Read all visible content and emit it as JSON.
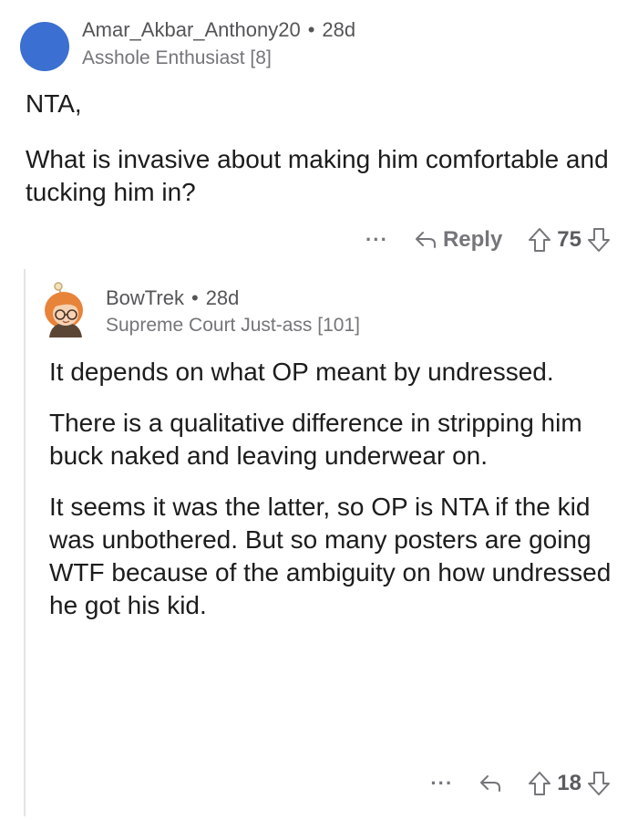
{
  "comment": {
    "author": "Amar_Akbar_Anthony20",
    "separator": "•",
    "age": "28d",
    "flair": "Asshole Enthusiast [8]",
    "avatar_color": "#3b6fd1",
    "paragraphs": [
      "NTA,",
      "What is invasive about making him comfortable and tucking him in?"
    ],
    "actions": {
      "more_label": "···",
      "reply_label": "Reply",
      "score": "75"
    }
  },
  "reply": {
    "author": "BowTrek",
    "separator": "•",
    "age": "28d",
    "flair": "Supreme Court Just-ass [101]",
    "paragraphs": [
      "It depends on what OP meant by undressed.",
      "There is a qualitative difference in stripping him buck naked and leaving underwear on.",
      "It seems it was the latter, so OP is NTA if the kid was unbothered. But so many posters are going WTF because of the ambiguity on how undressed he got his kid."
    ],
    "actions": {
      "more_label": "···",
      "score": "18"
    }
  },
  "colors": {
    "text": "#1c1c1c",
    "meta": "#75757a",
    "thread_line": "#e4e4e6"
  }
}
